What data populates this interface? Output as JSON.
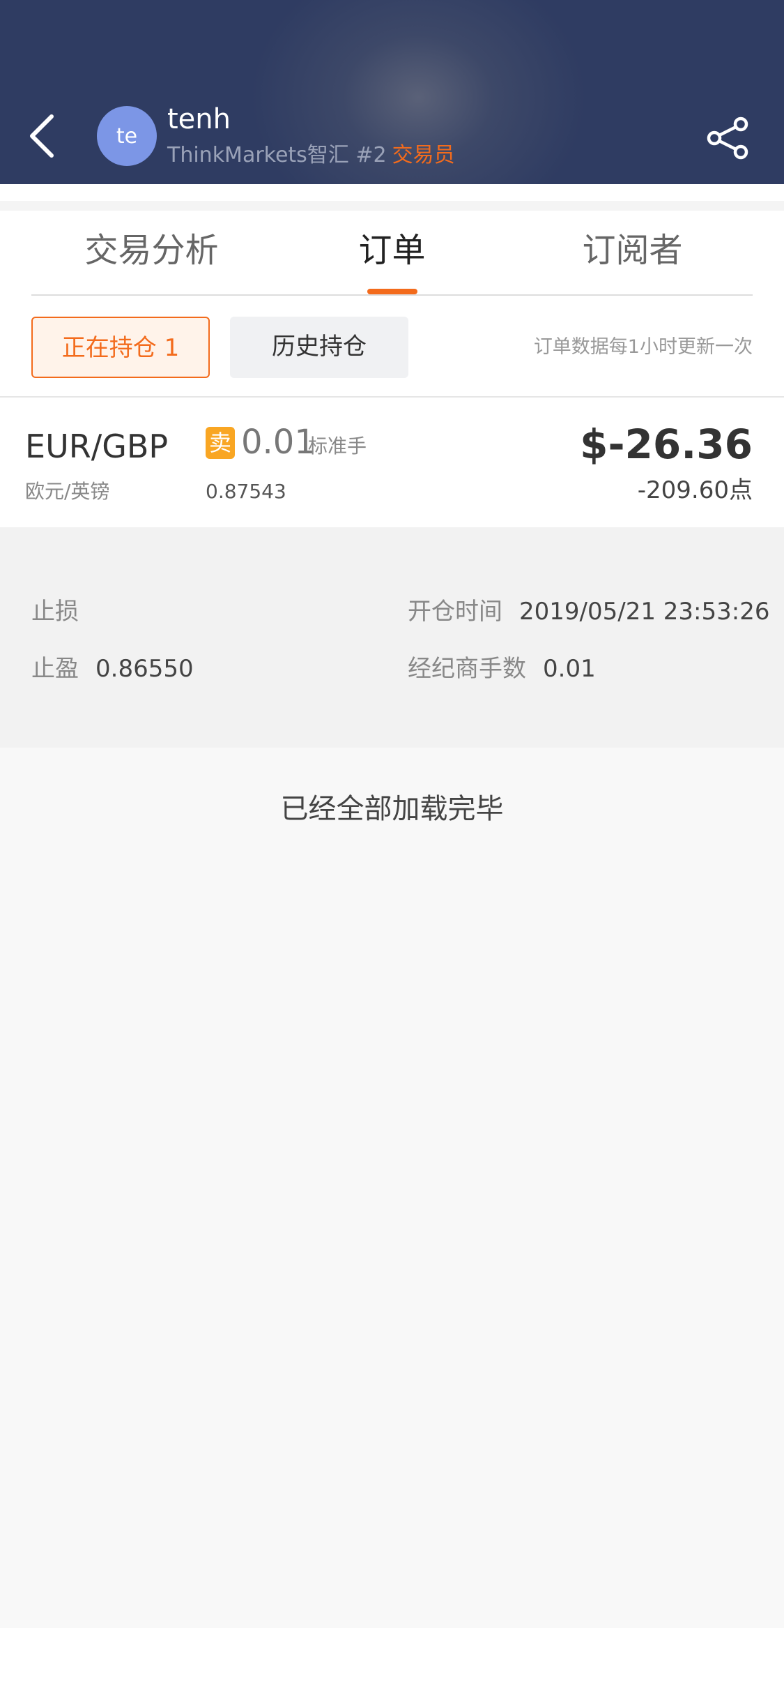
{
  "header": {
    "avatar_text": "te",
    "user_name": "tenh",
    "broker_rank": "ThinkMarkets智汇 #2",
    "role": "交易员",
    "icons": {
      "back": "back-arrow-icon",
      "share": "share-icon"
    }
  },
  "tabs": [
    {
      "label": "交易分析",
      "active": false
    },
    {
      "label": "订单",
      "active": true
    },
    {
      "label": "订阅者",
      "active": false
    }
  ],
  "filters": {
    "open_positions_label": "正在持仓 1",
    "history_label": "历史持仓",
    "update_note": "订单数据每1小时更新一次"
  },
  "order": {
    "symbol": "EUR/GBP",
    "symbol_name": "欧元/英镑",
    "side": "卖",
    "lots": "0.01",
    "lots_unit": "标准手",
    "open_price": "0.87543",
    "profit": "$-26.36",
    "points": "-209.60点"
  },
  "details": {
    "stop_loss_label": "止损",
    "stop_loss_value": "",
    "take_profit_label": "止盈",
    "take_profit_value": "0.86550",
    "open_time_label": "开仓时间",
    "open_time_value": "2019/05/21 23:53:26",
    "broker_lots_label": "经纪商手数",
    "broker_lots_value": "0.01"
  },
  "list_footer": "已经全部加载完毕",
  "colors": {
    "accent": "#f36b1c",
    "header_bg": "#2f3c62",
    "avatar_bg": "#7c96e6",
    "sell_badge": "#f9a623"
  }
}
